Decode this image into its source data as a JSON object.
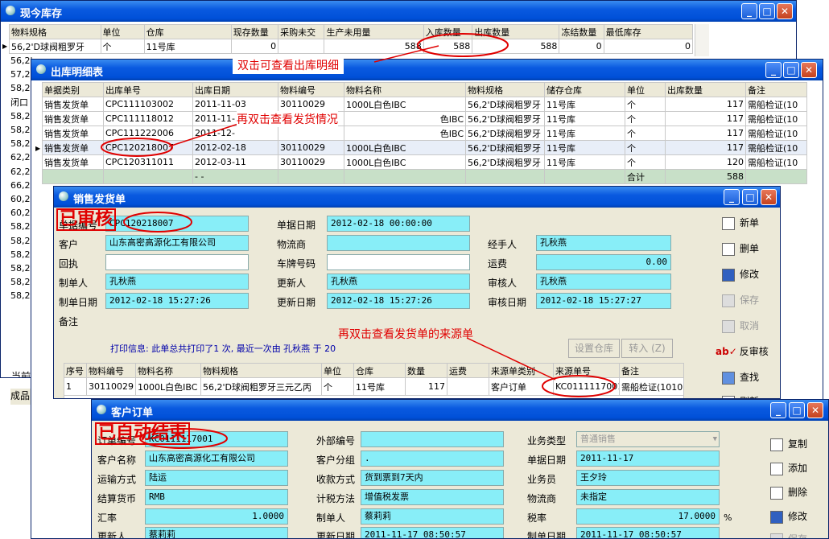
{
  "win1": {
    "title": "现今库存",
    "headers": [
      "物料规格",
      "单位",
      "仓库",
      "现存数量",
      "采购未交",
      "生产未用量",
      "入库数量",
      "出库数量",
      "冻结数量",
      "最低库存"
    ],
    "row": [
      "56,2'D球阀粗罗牙",
      "个",
      "11号库",
      "0",
      "",
      "588",
      "588",
      "588",
      "0",
      "0"
    ],
    "side_rows": [
      "56,2'",
      "57,2'",
      "58,2'",
      "闭口",
      "58,2'",
      "58,2'",
      "58,2'",
      "62,2'",
      "62,2'",
      "66,2'",
      "60,2'",
      "60,2'",
      "58,2'",
      "58,2'",
      "58,2'",
      "58,2'",
      "58,2'",
      "58,2'"
    ],
    "bottom_labels": [
      "当前",
      "成品"
    ]
  },
  "annot": {
    "a1": "双击可查看出库明细",
    "a2": "再双击查看发货情况",
    "a3": "再双击查看发货单的来源单",
    "stamp1": "已审核",
    "stamp2": "已自动结束"
  },
  "win2": {
    "title": "出库明细表",
    "headers": [
      "单据类别",
      "出库单号",
      "出库日期",
      "物料编号",
      "物料名称",
      "物料规格",
      "储存仓库",
      "单位",
      "出库数量",
      "备注"
    ],
    "rows": [
      [
        "销售发货单",
        "CPC111103002",
        "2011-11-03",
        "30110029",
        "1000L白色IBC",
        "56,2'D球阀粗罗牙",
        "11号库",
        "个",
        "117",
        "需船检证(10"
      ],
      [
        "销售发货单",
        "CPC111118012",
        "2011-11-",
        "",
        "色IBC",
        "56,2'D球阀粗罗牙",
        "11号库",
        "个",
        "117",
        "需船检证(10"
      ],
      [
        "销售发货单",
        "CPC111222006",
        "2011-12-",
        "",
        "色IBC",
        "56,2'D球阀粗罗牙",
        "11号库",
        "个",
        "117",
        "需船检证(10"
      ],
      [
        "销售发货单",
        "CPC120218007",
        "2012-02-18",
        "30110029",
        "1000L白色IBC",
        "56,2'D球阀粗罗牙",
        "11号库",
        "个",
        "117",
        "需船检证(10"
      ],
      [
        "销售发货单",
        "CPC120311011",
        "2012-03-11",
        "30110029",
        "1000L白色IBC",
        "56,2'D球阀粗罗牙",
        "11号库",
        "个",
        "120",
        "需船检证(10"
      ]
    ],
    "total_label": "合计",
    "total_value": "588",
    "total_dash": "- -"
  },
  "win3": {
    "title": "销售发货单",
    "labels": {
      "doc_no": "单据编号",
      "customer": "客户",
      "receipt": "回执",
      "maker": "制单人",
      "make_date": "制单日期",
      "remark": "备注",
      "doc_date": "单据日期",
      "logistics": "物流商",
      "plate": "车牌号码",
      "updater": "更新人",
      "update_date": "更新日期",
      "handler": "经手人",
      "freight": "运费",
      "auditor": "审核人",
      "audit_date": "审核日期"
    },
    "values": {
      "doc_no": "CPC120218007",
      "customer": "山东高密高源化工有限公司",
      "receipt": "",
      "maker": "孔秋燕",
      "make_date": "2012-02-18 15:27:26",
      "doc_date": "2012-02-18 00:00:00",
      "logistics": "",
      "plate": "",
      "updater": "孔秋燕",
      "update_date": "2012-02-18 15:27:26",
      "handler": "孔秋燕",
      "freight": "0.00",
      "auditor": "孔秋燕",
      "audit_date": "2012-02-18 15:27:27"
    },
    "print_info": "打印信息: 此单总共打印了1 次, 最近一次由  孔秋燕  于  20",
    "btn_set_wh": "设置仓库",
    "btn_transfer": "转入 (Z)",
    "headers": [
      "序号",
      "物料编号",
      "物料名称",
      "物料规格",
      "单位",
      "仓库",
      "数量",
      "运费",
      "来源单类别",
      "来源单号",
      "备注"
    ],
    "row": [
      "1",
      "30110029",
      "1000L白色IBC",
      "56,2'D球阀粗罗牙三元乙丙",
      "个",
      "11号库",
      "117",
      "",
      "客户订单",
      "KC0111117001",
      "需船检证(1010)"
    ],
    "total_label": "合计",
    "side": [
      "新单",
      "删单",
      "修改",
      "保存",
      "取消",
      "反审核",
      "查找",
      "刷新"
    ]
  },
  "win4": {
    "title": "客户订单",
    "labels": {
      "order_no": "订单编号",
      "cust_name": "客户名称",
      "transport": "运输方式",
      "currency": "结算货币",
      "rate": "汇率",
      "updater": "更新人",
      "ext_no": "外部编号",
      "cust_group": "客户分组",
      "pay_method": "收款方式",
      "tax_method": "计税方法",
      "maker": "制单人",
      "update_date": "更新日期",
      "biz_type": "业务类型",
      "doc_date": "单据日期",
      "salesman": "业务员",
      "logistics": "物流商",
      "tax_rate": "税率",
      "make_date": "制单日期"
    },
    "values": {
      "order_no": "KC0111117001",
      "cust_name": "山东高密高源化工有限公司",
      "transport": "陆运",
      "currency": "RMB",
      "rate": "1.0000",
      "updater": "蔡莉莉",
      "ext_no": "",
      "cust_group": ".",
      "pay_method": "货到票到7天内",
      "tax_method": "增值税发票",
      "maker": "蔡莉莉",
      "update_date": "2011-11-17 08:50:57",
      "biz_type": "普通销售",
      "doc_date": "2011-11-17",
      "salesman": "王夕玲",
      "logistics": "未指定",
      "tax_rate": "17.0000",
      "make_date": "2011-11-17 08:50:57"
    },
    "percent": "%",
    "side": [
      "复制",
      "添加",
      "删除",
      "修改",
      "保存"
    ]
  }
}
